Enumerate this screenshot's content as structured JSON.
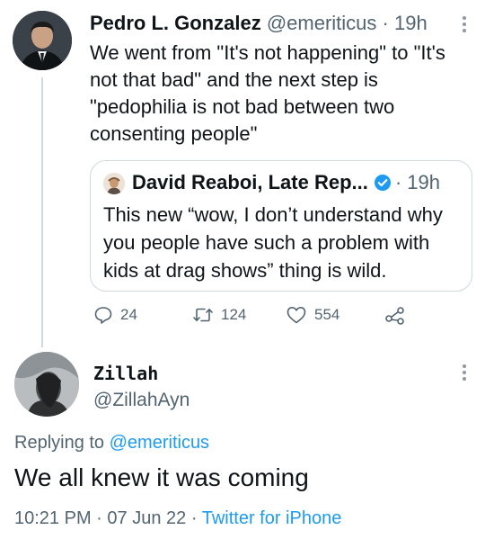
{
  "tweet1": {
    "name": "Pedro L. Gonzalez",
    "handle": "@emeriticus",
    "sep": "·",
    "time": "19h",
    "text": "We went from \"It's not happening\" to \"It's not that bad\" and the next step is \"pedophilia is not bad between two consenting people\"",
    "quote": {
      "name": "David Reaboi, Late Rep...",
      "sep": "·",
      "time": "19h",
      "text": "This new “wow, I don’t understand why you people have such a problem with kids at drag shows” thing is wild."
    },
    "actions": {
      "replies": "24",
      "retweets": "124",
      "likes": "554"
    }
  },
  "tweet2": {
    "name": "Zillah",
    "handle": "@ZillahAyn",
    "replying_prefix": "Replying to ",
    "replying_to": "@emeriticus",
    "text": "We all knew it was coming",
    "time": "10:21 PM",
    "date": "07 Jun 22",
    "sep": "·",
    "source": "Twitter for iPhone"
  },
  "colors": {
    "text": "#0f1419",
    "secondary": "#536471",
    "link": "#1d9bf0",
    "border": "#cfd9de"
  }
}
